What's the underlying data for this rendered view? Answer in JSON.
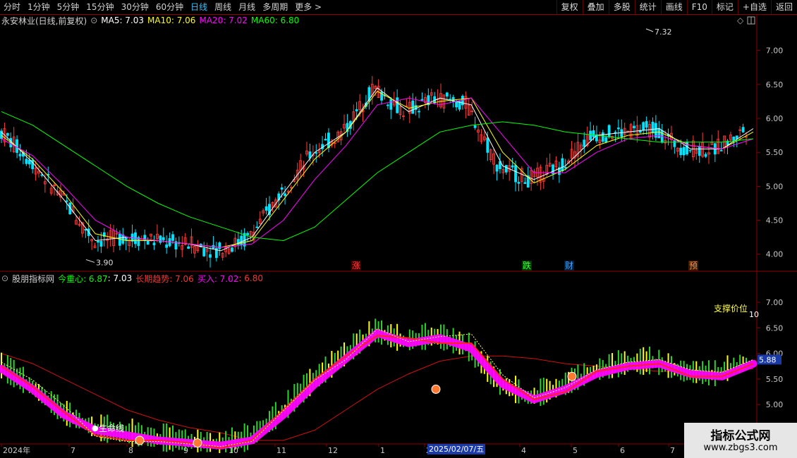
{
  "toolbar": {
    "periods": [
      "分时",
      "1分钟",
      "5分钟",
      "15分钟",
      "30分钟",
      "60分钟",
      "日线",
      "周线",
      "月线",
      "多周期",
      "更多 >"
    ],
    "active_period": "日线",
    "buttons": [
      "复权",
      "叠加",
      "多股",
      "统计",
      "画线",
      "F10",
      "标记",
      "+自选",
      "返回"
    ]
  },
  "main_legend": {
    "title": "永安林业(日线,前复权)",
    "ma5": "MA5: 7.03",
    "ma10": "MA10: 7.06",
    "ma20": "MA20: 7.02",
    "ma60": "MA60: 6.80",
    "colors": {
      "ma5": "#ffffff",
      "ma10": "#ffff00",
      "ma20": "#ff00ff",
      "ma60": "#00ff00"
    }
  },
  "main_annotations": {
    "high_label": "7.32",
    "low_label": "3.90",
    "event_zhang": "涨",
    "event_die": "跌",
    "event_cai": "财",
    "event_yu": "预"
  },
  "sub_legend": {
    "title": "股朋指标网",
    "center": "今重心: 6.87",
    "center_b": ": 7.03",
    "trend": "长期趋势: 7.06",
    "buy": "买入: 7.02",
    "buy_b": ": 6.80"
  },
  "sub_annotations": {
    "support": "支撑价位",
    "support_b": "10",
    "lifeline": "生命线",
    "price_tag": "5.88"
  },
  "x_axis": {
    "labels": [
      "2024年",
      "7",
      "8",
      "9",
      "10",
      "11",
      "12",
      "1",
      "2",
      "2025/02/07/五",
      "4",
      "5",
      "6",
      "7"
    ]
  },
  "watermark": {
    "line1": "指标公式网",
    "line2": "www.zbgs3.com"
  },
  "chart_data": [
    {
      "type": "line",
      "title": "永安林业(日线,前复权)",
      "ylim": [
        3.8,
        7.35
      ],
      "y_ticks": [
        4.0,
        4.5,
        5.0,
        5.5,
        6.0,
        6.5,
        7.0
      ],
      "x": [
        0,
        10,
        20,
        30,
        40,
        50,
        60,
        70,
        80,
        90,
        100,
        110,
        120,
        130,
        140,
        150,
        160,
        170,
        180,
        190,
        200,
        210,
        220,
        230,
        240
      ],
      "series": [
        {
          "name": "MA5",
          "values": [
            5.8,
            5.35,
            4.8,
            4.2,
            4.25,
            4.2,
            4.15,
            4.05,
            4.25,
            4.9,
            5.5,
            5.8,
            6.45,
            6.1,
            6.3,
            6.2,
            5.3,
            5.1,
            5.3,
            5.75,
            5.8,
            5.85,
            5.55,
            5.55,
            5.85
          ]
        },
        {
          "name": "MA10",
          "values": [
            5.75,
            5.4,
            4.9,
            4.3,
            4.2,
            4.2,
            4.15,
            4.1,
            4.2,
            4.8,
            5.4,
            5.8,
            6.4,
            6.15,
            6.25,
            6.3,
            5.5,
            5.05,
            5.25,
            5.6,
            5.75,
            5.8,
            5.6,
            5.55,
            5.8
          ]
        },
        {
          "name": "MA20",
          "values": [
            5.7,
            5.45,
            5.0,
            4.5,
            4.25,
            4.2,
            4.15,
            4.1,
            4.15,
            4.5,
            5.1,
            5.6,
            6.2,
            6.3,
            6.2,
            6.3,
            5.75,
            5.2,
            5.2,
            5.5,
            5.7,
            5.75,
            5.6,
            5.55,
            5.7
          ]
        },
        {
          "name": "MA60",
          "values": [
            6.1,
            5.9,
            5.6,
            5.3,
            5.0,
            4.75,
            4.55,
            4.4,
            4.25,
            4.2,
            4.4,
            4.8,
            5.2,
            5.5,
            5.8,
            5.9,
            5.95,
            5.9,
            5.8,
            5.75,
            5.7,
            5.65,
            5.65,
            5.65,
            5.7
          ]
        }
      ],
      "low": 3.9,
      "high": 7.32
    },
    {
      "type": "line",
      "title": "股朋指标网",
      "ylim": [
        4.3,
        7.4
      ],
      "y_ticks": [
        4.5,
        5.0,
        5.5,
        6.0,
        6.5,
        7.0
      ],
      "series": [
        {
          "name": "今重心",
          "values": [
            5.7,
            5.3,
            4.8,
            4.5,
            4.4,
            4.3,
            4.25,
            4.2,
            4.3,
            4.8,
            5.4,
            5.9,
            6.4,
            6.2,
            6.3,
            6.1,
            5.4,
            5.1,
            5.3,
            5.6,
            5.75,
            5.8,
            5.6,
            5.55,
            5.8
          ]
        },
        {
          "name": "长期趋势",
          "values": [
            6.0,
            5.8,
            5.5,
            5.2,
            4.9,
            4.7,
            4.55,
            4.45,
            4.3,
            4.3,
            4.5,
            4.9,
            5.3,
            5.6,
            5.85,
            5.95,
            5.95,
            5.9,
            5.8,
            5.75,
            5.7,
            5.65,
            5.65,
            5.65,
            5.7
          ]
        },
        {
          "name": "买入",
          "values": [
            5.75,
            5.35,
            4.85,
            4.4,
            4.3,
            4.3,
            4.25,
            4.15,
            4.3,
            4.9,
            5.5,
            5.95,
            6.35,
            6.3,
            6.2,
            6.2,
            5.5,
            5.1,
            5.25,
            5.65,
            5.75,
            5.8,
            5.55,
            5.55,
            5.8
          ]
        }
      ],
      "price_tag": 5.88
    }
  ]
}
